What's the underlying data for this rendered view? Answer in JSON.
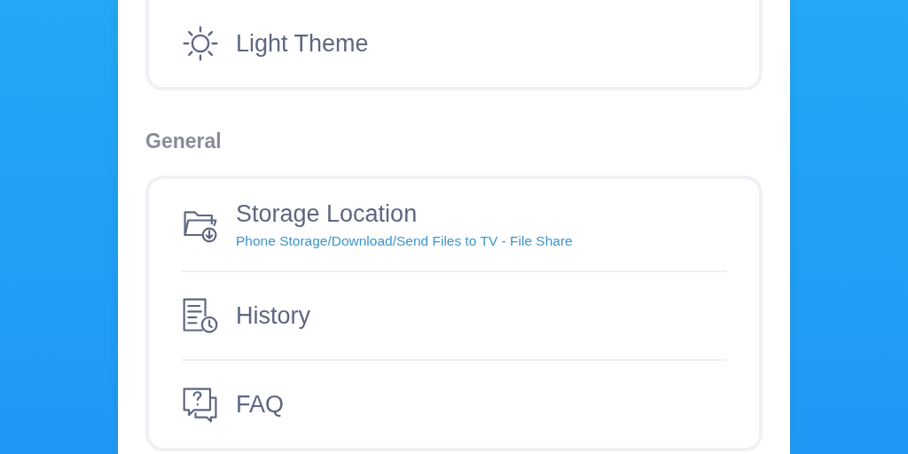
{
  "sections": [
    {
      "items": [
        {
          "title": "Light Theme"
        }
      ]
    },
    {
      "heading": "General",
      "items": [
        {
          "title": "Storage Location",
          "subtitle": "Phone Storage/Download/Send Files to TV - File Share"
        },
        {
          "title": "History"
        },
        {
          "title": "FAQ"
        }
      ]
    }
  ]
}
